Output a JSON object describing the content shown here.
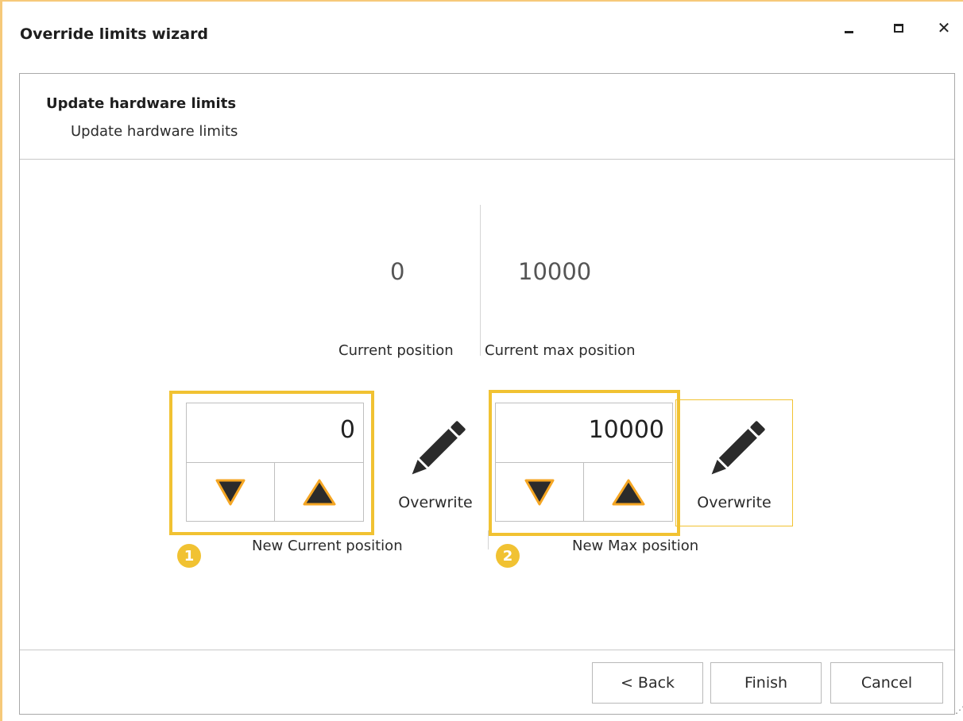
{
  "window": {
    "title": "Override limits wizard",
    "controls": {
      "minimize_icon": "minimize-icon",
      "maximize_icon": "maximize-icon",
      "close_icon": "close-icon",
      "close_glyph": "✕"
    },
    "accent_color": "#f6c97a"
  },
  "page": {
    "title": "Update hardware limits",
    "subtitle": "Update hardware limits"
  },
  "current": {
    "position_value": "0",
    "position_label": "Current position",
    "max_value": "10000",
    "max_label": "Current max position"
  },
  "new_current": {
    "value": "0",
    "label": "New Current position",
    "decrement_icon": "triangle-down-icon",
    "increment_icon": "triangle-up-icon",
    "overwrite_label": "Overwrite",
    "overwrite_icon": "pencil-icon",
    "badge": "1"
  },
  "new_max": {
    "value": "10000",
    "label": "New Max position",
    "decrement_icon": "triangle-down-icon",
    "increment_icon": "triangle-up-icon",
    "overwrite_label": "Overwrite",
    "overwrite_icon": "pencil-icon",
    "badge": "2"
  },
  "footer": {
    "back_label": "< Back",
    "finish_label": "Finish",
    "cancel_label": "Cancel"
  },
  "colors": {
    "highlight": "#f1c232",
    "triangle_fill": "#2b2b2b",
    "triangle_outline": "#f5a623"
  }
}
